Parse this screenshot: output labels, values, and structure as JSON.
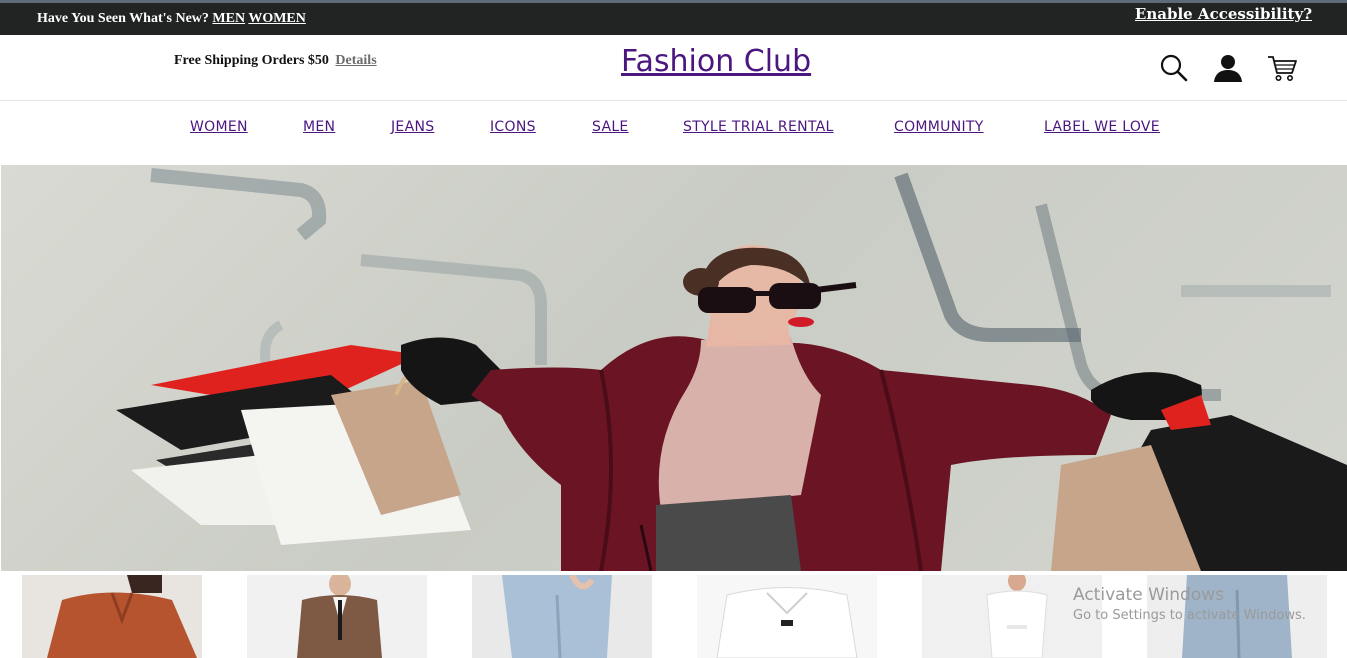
{
  "topbar": {
    "announce_text": "Have You Seen What's New?",
    "link_men": "MEN",
    "link_women": "WOMEN",
    "accessibility": "Enable Accessibility?"
  },
  "header": {
    "shipping_text": "Free Shipping Orders $50",
    "details_link": "Details",
    "logo": "Fashion Club",
    "icons": [
      "search-icon",
      "account-icon",
      "cart-icon"
    ]
  },
  "nav": {
    "items": [
      "WOMEN",
      "MEN",
      "JEANS",
      "ICONS",
      "SALE",
      "STYLE TRIAL RENTAL",
      "COMMUNITY",
      "LABEL WE LOVE"
    ]
  },
  "colors": {
    "topbar_bg": "#222424",
    "brand_purple": "#4b1680",
    "coat_burgundy": "#6a1424"
  },
  "watermark": {
    "line1": "Activate Windows",
    "line2": "Go to Settings to activate Windows."
  }
}
